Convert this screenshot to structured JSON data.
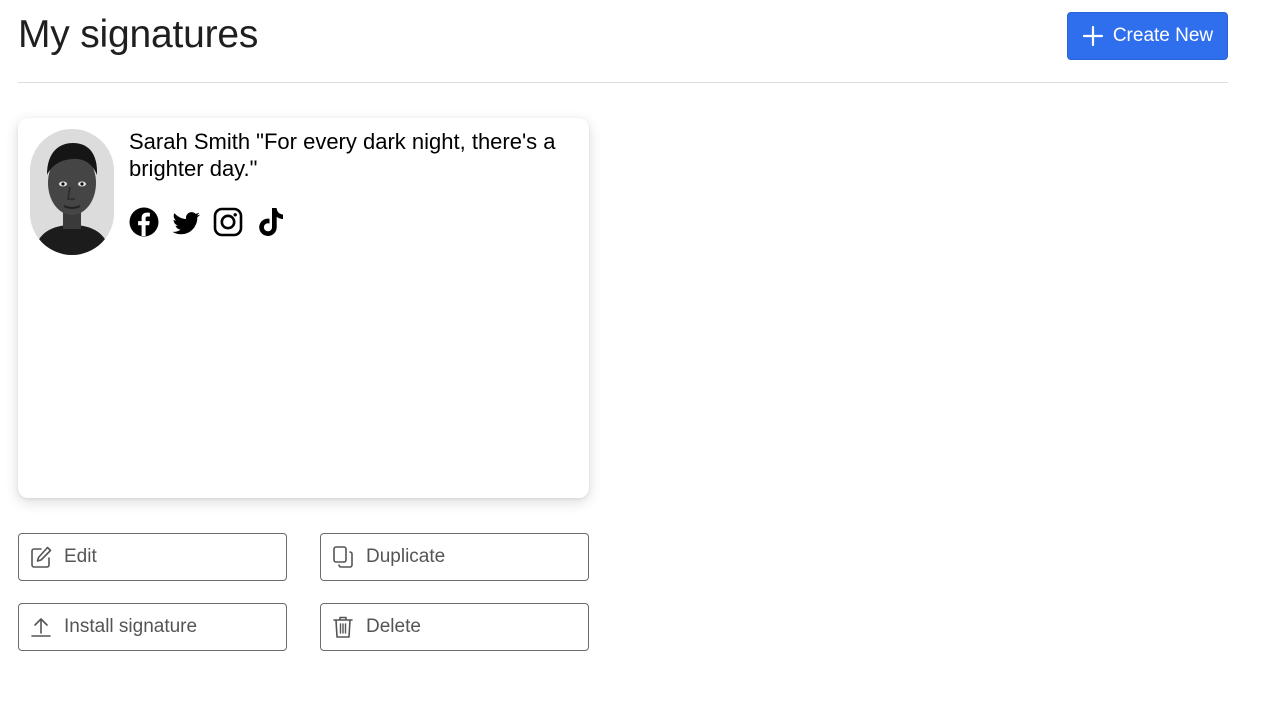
{
  "header": {
    "title": "My signatures",
    "create_button_label": "Create New",
    "accent_color": "#2f6fed"
  },
  "signature": {
    "text": "Sarah Smith \"For every dark night, there's a brighter day.\"",
    "avatar": "portrait-photo",
    "social_icons": [
      "facebook-icon",
      "twitter-icon",
      "instagram-icon",
      "tiktok-icon"
    ]
  },
  "actions": {
    "edit_label": "Edit",
    "duplicate_label": "Duplicate",
    "install_label": "Install signature",
    "delete_label": "Delete"
  }
}
